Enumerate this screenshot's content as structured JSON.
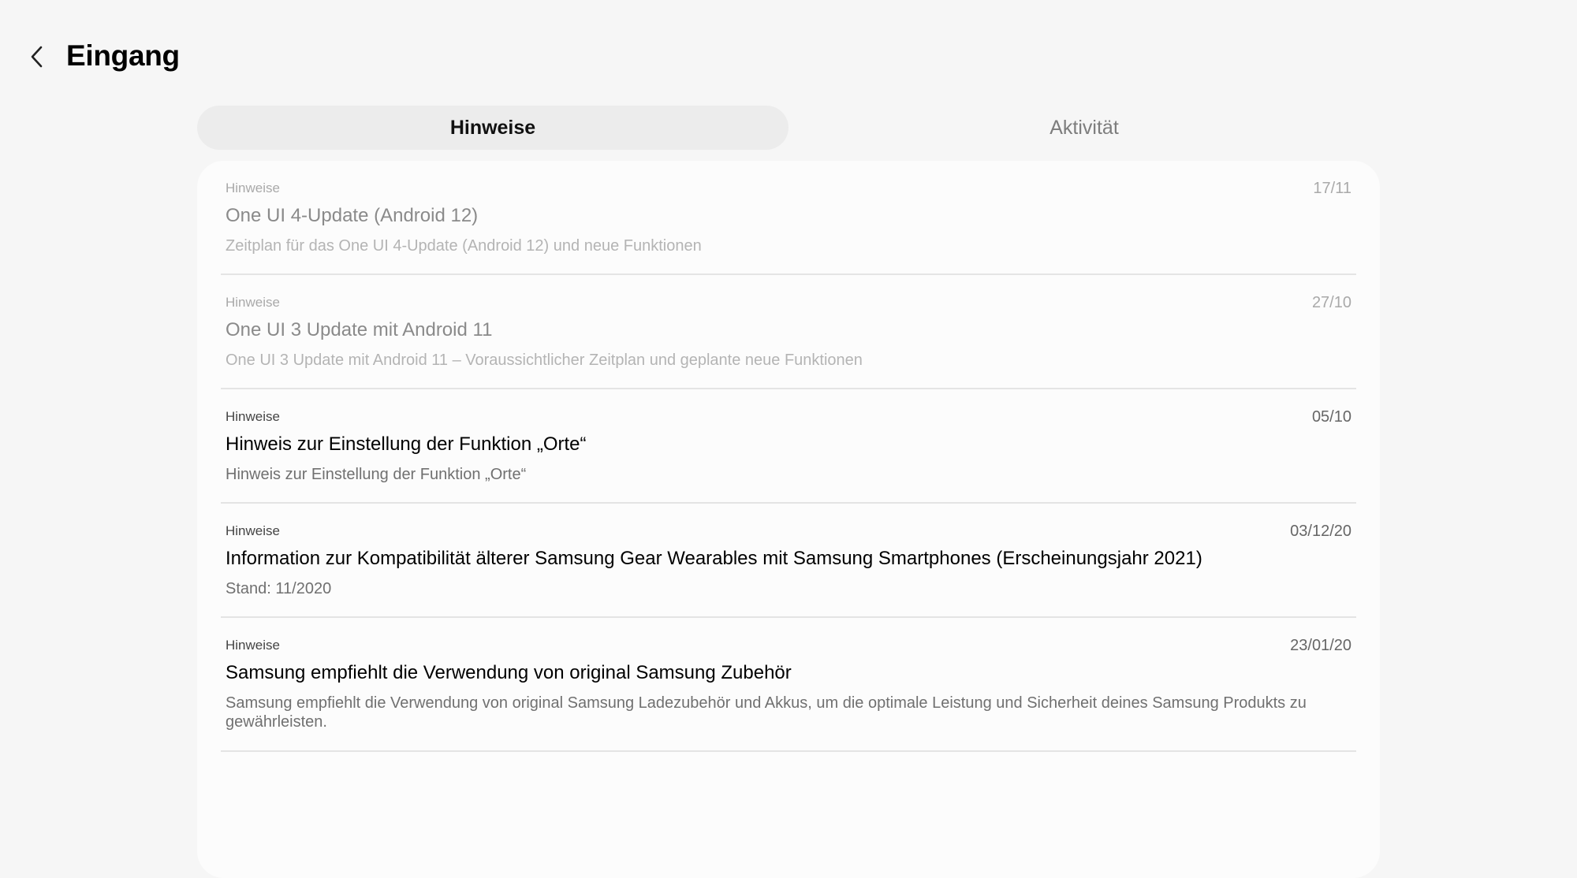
{
  "header": {
    "title": "Eingang",
    "back_icon": "chevron-left-icon"
  },
  "tabs": [
    {
      "label": "Hinweise",
      "active": true
    },
    {
      "label": "Aktivität",
      "active": false
    }
  ],
  "notices": [
    {
      "category": "Hinweise",
      "date": "17/11",
      "title": "One UI 4-Update (Android 12)",
      "description": "Zeitplan für das One UI 4-Update (Android 12) und neue Funktionen",
      "read": true
    },
    {
      "category": "Hinweise",
      "date": "27/10",
      "title": "One UI 3 Update mit Android 11",
      "description": "One UI 3 Update mit Android 11 – Voraussichtlicher Zeitplan und geplante neue Funktionen",
      "read": true
    },
    {
      "category": "Hinweise",
      "date": "05/10",
      "title": "Hinweis zur Einstellung der Funktion „Orte“",
      "description": "Hinweis zur Einstellung der Funktion „Orte“",
      "read": false
    },
    {
      "category": "Hinweise",
      "date": "03/12/20",
      "title": "Information zur Kompatibilität älterer Samsung Gear Wearables mit Samsung Smartphones (Erscheinungsjahr 2021)",
      "description": "Stand: 11/2020",
      "read": false
    },
    {
      "category": "Hinweise",
      "date": "23/01/20",
      "title": "Samsung empfiehlt die Verwendung von original Samsung Zubehör",
      "description": "Samsung empfiehlt die Verwendung von original Samsung Ladezubehör und Akkus, um die optimale Leistung und Sicherheit deines Samsung Produkts zu gewährleisten.",
      "read": false
    }
  ]
}
